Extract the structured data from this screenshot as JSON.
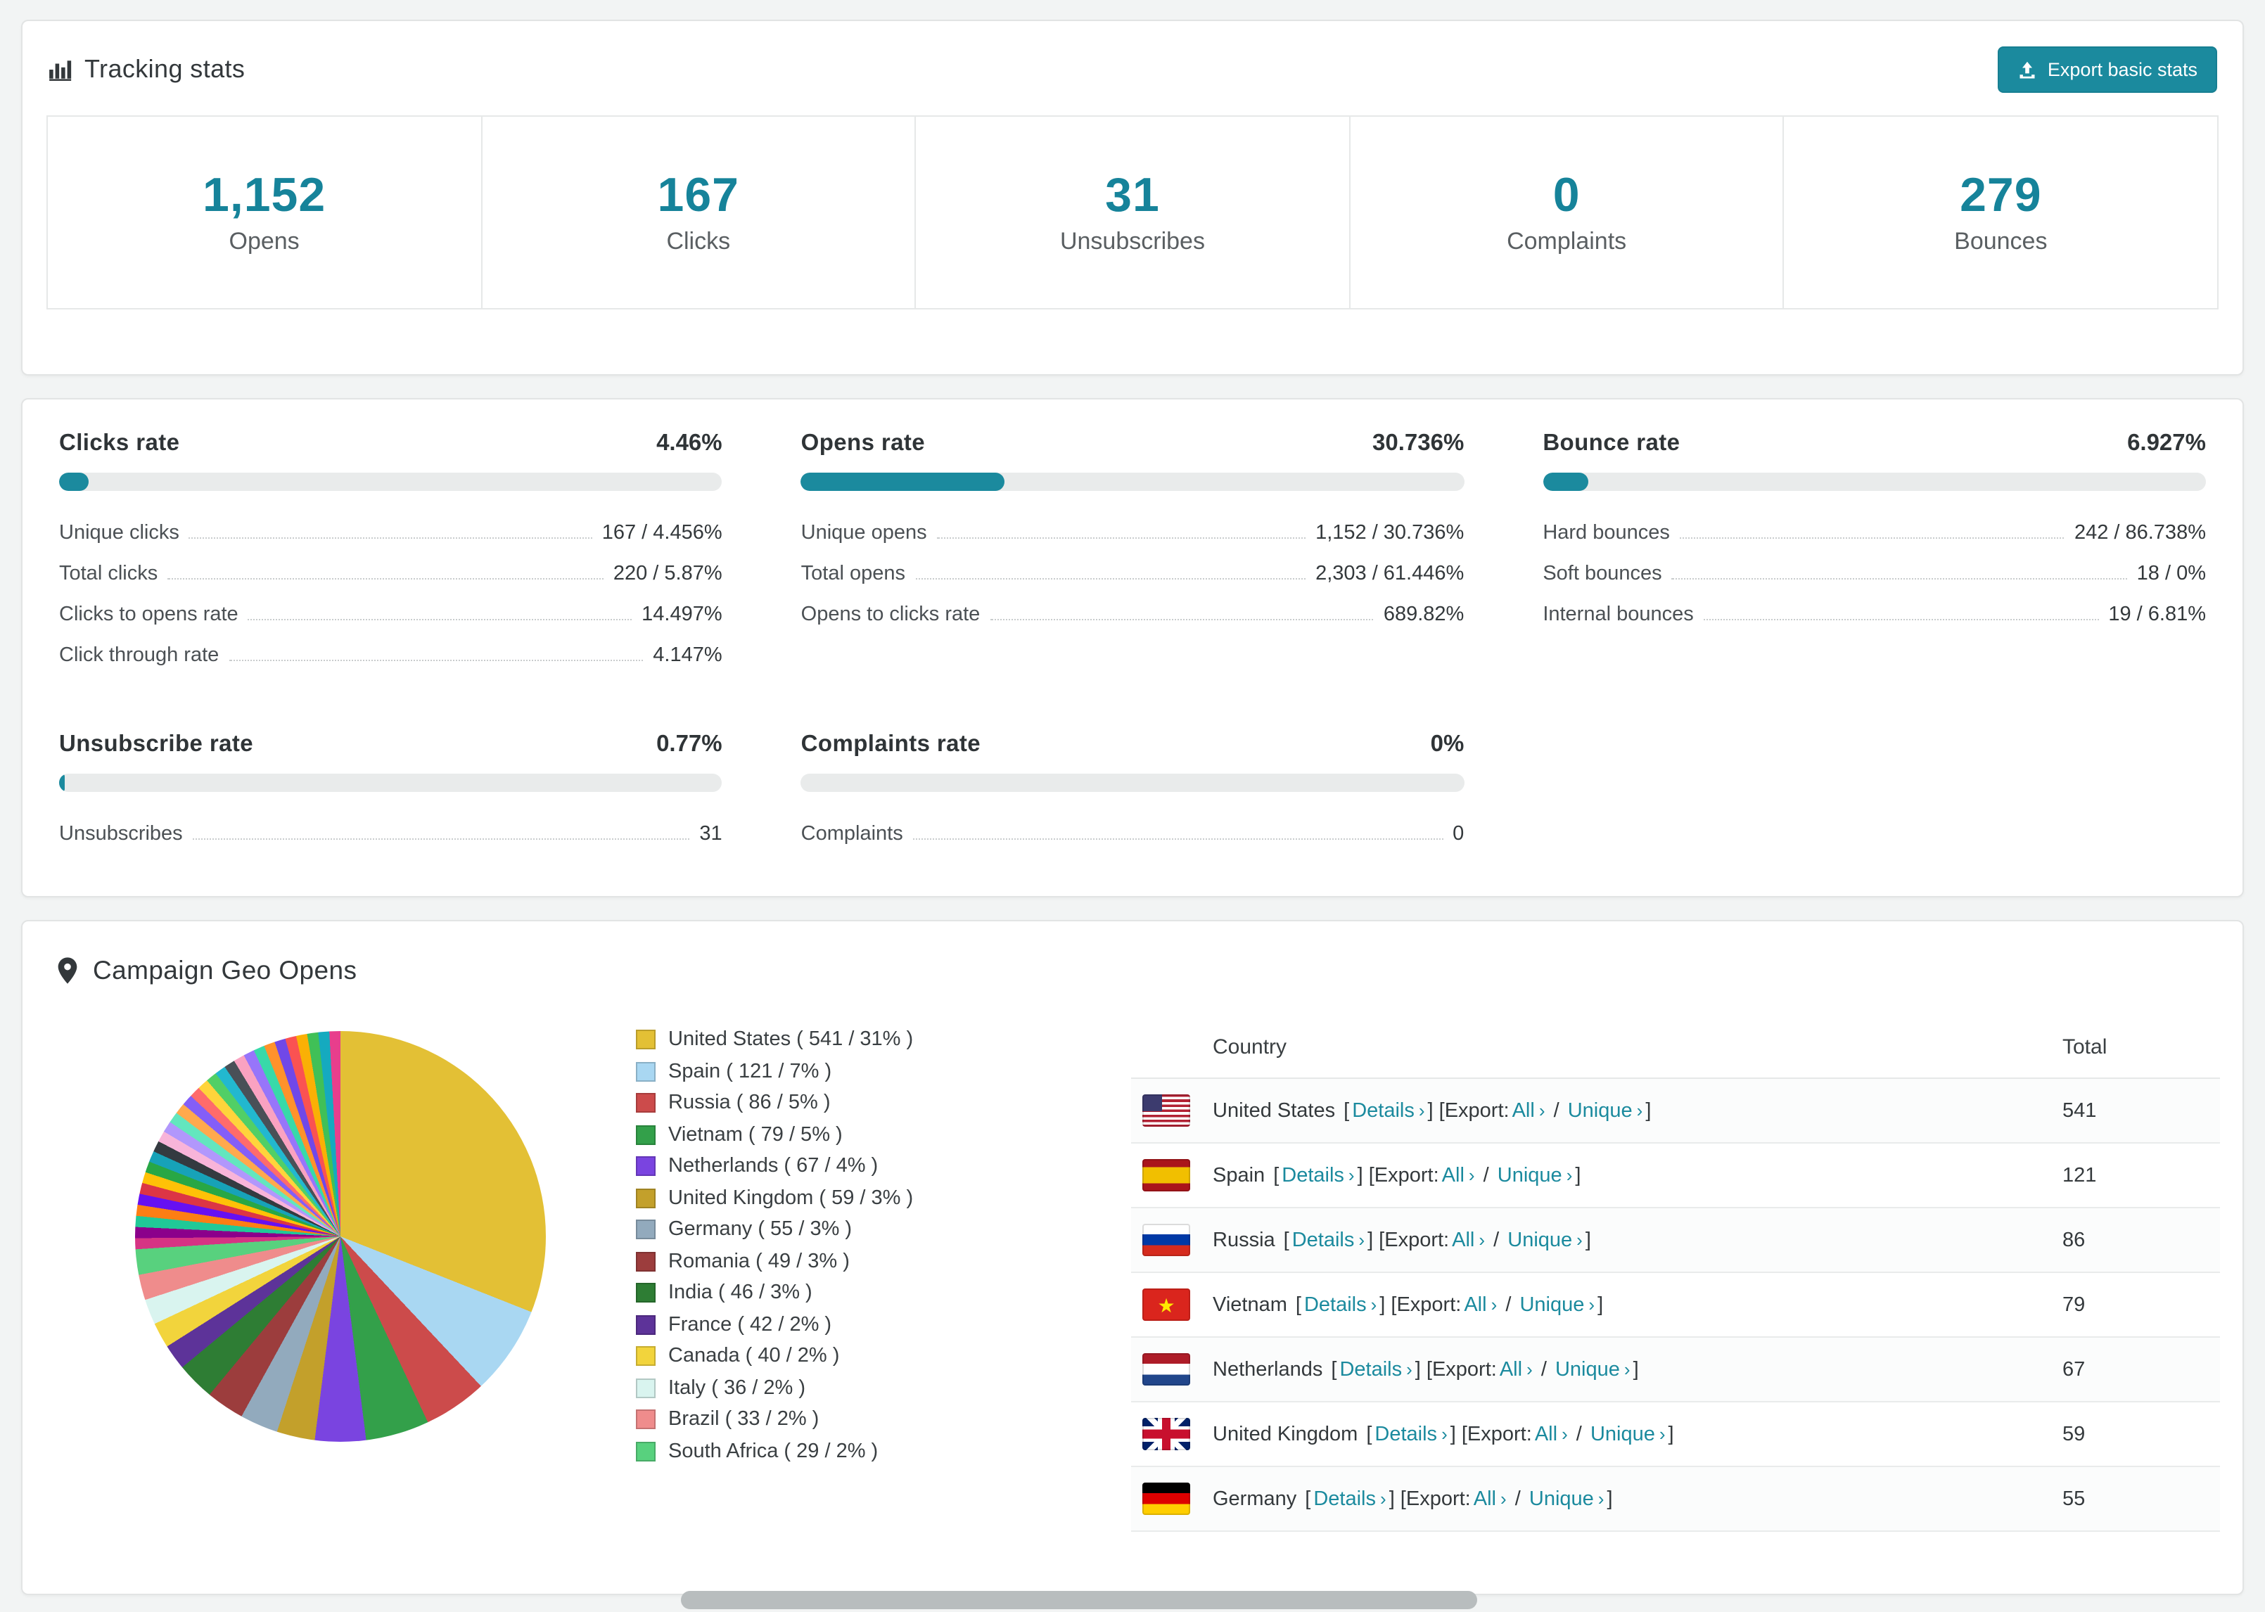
{
  "accent_color": "#1b8a9e",
  "number_color": "#16839a",
  "tracking": {
    "title": "Tracking stats",
    "export_label": "Export basic stats",
    "stats": [
      {
        "value": "1,152",
        "label": "Opens"
      },
      {
        "value": "167",
        "label": "Clicks"
      },
      {
        "value": "31",
        "label": "Unsubscribes"
      },
      {
        "value": "0",
        "label": "Complaints"
      },
      {
        "value": "279",
        "label": "Bounces"
      }
    ]
  },
  "rates": [
    {
      "title": "Clicks rate",
      "value": "4.46%",
      "percent": 4.46,
      "rows": [
        {
          "label": "Unique clicks",
          "value": "167 / 4.456%"
        },
        {
          "label": "Total clicks",
          "value": "220 / 5.87%"
        },
        {
          "label": "Clicks to opens rate",
          "value": "14.497%"
        },
        {
          "label": "Click through rate",
          "value": "4.147%"
        }
      ]
    },
    {
      "title": "Opens rate",
      "value": "30.736%",
      "percent": 30.736,
      "rows": [
        {
          "label": "Unique opens",
          "value": "1,152 / 30.736%"
        },
        {
          "label": "Total opens",
          "value": "2,303 / 61.446%"
        },
        {
          "label": "Opens to clicks rate",
          "value": "689.82%"
        }
      ]
    },
    {
      "title": "Bounce rate",
      "value": "6.927%",
      "percent": 6.927,
      "rows": [
        {
          "label": "Hard bounces",
          "value": "242 / 86.738%"
        },
        {
          "label": "Soft bounces",
          "value": "18 / 0%"
        },
        {
          "label": "Internal bounces",
          "value": "19 / 6.81%"
        }
      ]
    },
    {
      "title": "Unsubscribe rate",
      "value": "0.77%",
      "percent": 0.77,
      "rows": [
        {
          "label": "Unsubscribes",
          "value": "31"
        }
      ]
    },
    {
      "title": "Complaints rate",
      "value": "0%",
      "percent": 0,
      "rows": [
        {
          "label": "Complaints",
          "value": "0"
        }
      ]
    }
  ],
  "geo": {
    "title": "Campaign Geo Opens",
    "links": {
      "open": "[",
      "details": "Details",
      "chev": "›",
      "close_open_export": "] [Export:",
      "all": "All",
      "slash": " / ",
      "unique": "Unique",
      "close": "]"
    },
    "table": {
      "headers": {
        "country": "Country",
        "total": "Total"
      },
      "rows": [
        {
          "country": "United States",
          "total": "541"
        },
        {
          "country": "Spain",
          "total": "121"
        },
        {
          "country": "Russia",
          "total": "86"
        },
        {
          "country": "Vietnam",
          "total": "79"
        },
        {
          "country": "Netherlands",
          "total": "67"
        },
        {
          "country": "United Kingdom",
          "total": "59"
        },
        {
          "country": "Germany",
          "total": "55"
        }
      ]
    }
  },
  "chart_data": {
    "type": "pie",
    "title": "Campaign Geo Opens",
    "legend_position": "right",
    "slices": [
      {
        "label": "United States",
        "value": 541,
        "pct": 31,
        "color": "#e3c035",
        "text": "United States ( 541 / 31% )"
      },
      {
        "label": "Spain",
        "value": 121,
        "pct": 7,
        "color": "#a9d7f2",
        "text": "Spain ( 121 / 7% )"
      },
      {
        "label": "Russia",
        "value": 86,
        "pct": 5,
        "color": "#cc4b4b",
        "text": "Russia ( 86 / 5% )"
      },
      {
        "label": "Vietnam",
        "value": 79,
        "pct": 5,
        "color": "#33a04a",
        "text": "Vietnam ( 79 / 5% )"
      },
      {
        "label": "Netherlands",
        "value": 67,
        "pct": 4,
        "color": "#7a44e0",
        "text": "Netherlands ( 67 / 4% )"
      },
      {
        "label": "United Kingdom",
        "value": 59,
        "pct": 3,
        "color": "#c3a02b",
        "text": "United Kingdom ( 59 / 3% )"
      },
      {
        "label": "Germany",
        "value": 55,
        "pct": 3,
        "color": "#92aabd",
        "text": "Germany ( 55 / 3% )"
      },
      {
        "label": "Romania",
        "value": 49,
        "pct": 3,
        "color": "#9c3d3d",
        "text": "Romania ( 49 / 3% )"
      },
      {
        "label": "India",
        "value": 46,
        "pct": 3,
        "color": "#2e7d34",
        "text": "India ( 46 / 3% )"
      },
      {
        "label": "France",
        "value": 42,
        "pct": 2,
        "color": "#5d3399",
        "text": "France ( 42 / 2% )"
      },
      {
        "label": "Canada",
        "value": 40,
        "pct": 2,
        "color": "#f2d43c",
        "text": "Canada ( 40 / 2% )"
      },
      {
        "label": "Italy",
        "value": 36,
        "pct": 2,
        "color": "#d9f4ef",
        "text": "Italy ( 36 / 2% )"
      },
      {
        "label": "Brazil",
        "value": 33,
        "pct": 2,
        "color": "#ef8c8c",
        "text": "Brazil ( 33 / 2% )"
      },
      {
        "label": "South Africa",
        "value": 29,
        "pct": 2,
        "color": "#58d17e",
        "text": "South Africa ( 29 / 2% )"
      }
    ],
    "other_colors": [
      "#d63384",
      "#8b008b",
      "#20c997",
      "#fd7e14",
      "#6610f2",
      "#dc3545",
      "#ffc107",
      "#28a745",
      "#17a2b8",
      "#343a40",
      "#f8b4d9",
      "#b197fc",
      "#63e6be",
      "#ffa94d",
      "#845ef7",
      "#ff6b6b",
      "#ffd43b",
      "#51cf66",
      "#22b8cf",
      "#495057",
      "#faa2c1",
      "#9775fa",
      "#38d9a9",
      "#ff922b",
      "#7048e8",
      "#fa5252",
      "#fab005",
      "#40c057",
      "#15aabf",
      "#e83e8c"
    ]
  }
}
